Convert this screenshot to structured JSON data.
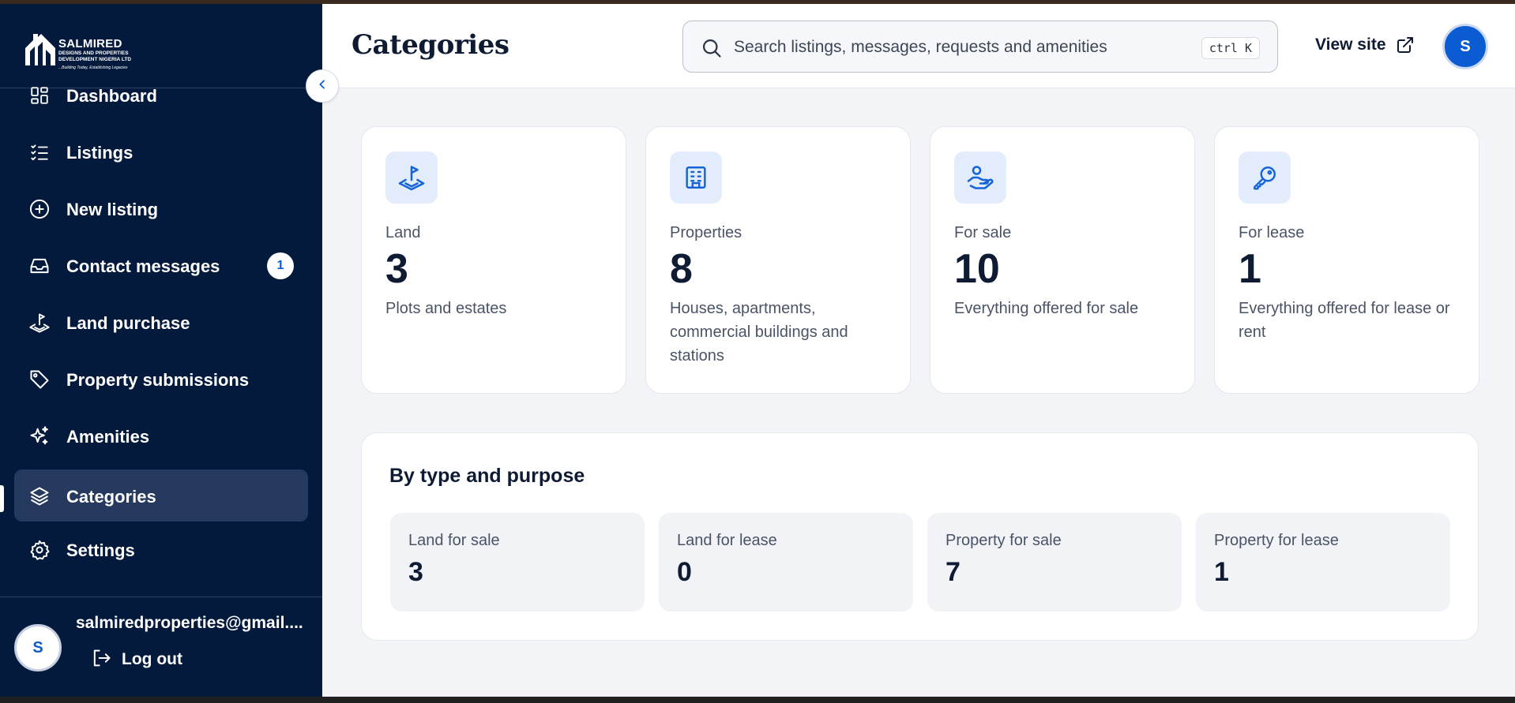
{
  "brand": {
    "name": "SALMIRED",
    "subtitle": "DESIGNS AND PROPERTIES DEVELOPMENT NIGERIA LTD",
    "tagline": "...Building Today, Establishing Legacies"
  },
  "sidebar": {
    "items": [
      {
        "label": "Dashboard",
        "icon": "dashboard-icon"
      },
      {
        "label": "Listings",
        "icon": "list-check-icon"
      },
      {
        "label": "New listing",
        "icon": "plus-circle-icon"
      },
      {
        "label": "Contact messages",
        "icon": "inbox-icon",
        "badge": "1"
      },
      {
        "label": "Land purchase",
        "icon": "land-flag-icon"
      },
      {
        "label": "Property submissions",
        "icon": "tag-icon"
      },
      {
        "label": "Amenities",
        "icon": "sparkles-icon"
      },
      {
        "label": "Categories",
        "icon": "layers-icon",
        "active": true
      },
      {
        "label": "Settings",
        "icon": "gear-icon"
      }
    ],
    "user": {
      "initial": "S",
      "email": "salmiredproperties@gmail....",
      "logout_label": "Log out"
    }
  },
  "header": {
    "title": "Categories",
    "search_placeholder": "Search listings, messages, requests and amenities",
    "shortcut": "ctrl K",
    "view_site_label": "View site",
    "avatar_initial": "S"
  },
  "stats": [
    {
      "label": "Land",
      "value": "3",
      "description": "Plots and estates",
      "icon": "land-flag-icon"
    },
    {
      "label": "Properties",
      "value": "8",
      "description": "Houses, apartments, commercial buildings and stations",
      "icon": "building-icon"
    },
    {
      "label": "For sale",
      "value": "10",
      "description": "Everything offered for sale",
      "icon": "hand-coin-icon"
    },
    {
      "label": "For lease",
      "value": "1",
      "description": "Everything offered for lease or rent",
      "icon": "key-icon"
    }
  ],
  "by_type": {
    "title": "By type and purpose",
    "tiles": [
      {
        "label": "Land for sale",
        "value": "3"
      },
      {
        "label": "Land for lease",
        "value": "0"
      },
      {
        "label": "Property for sale",
        "value": "7"
      },
      {
        "label": "Property for lease",
        "value": "1"
      }
    ]
  },
  "colors": {
    "sidebar_bg": "#031a3d",
    "accent": "#0b5bd3",
    "icon_tile_bg": "#e3ecfa"
  }
}
